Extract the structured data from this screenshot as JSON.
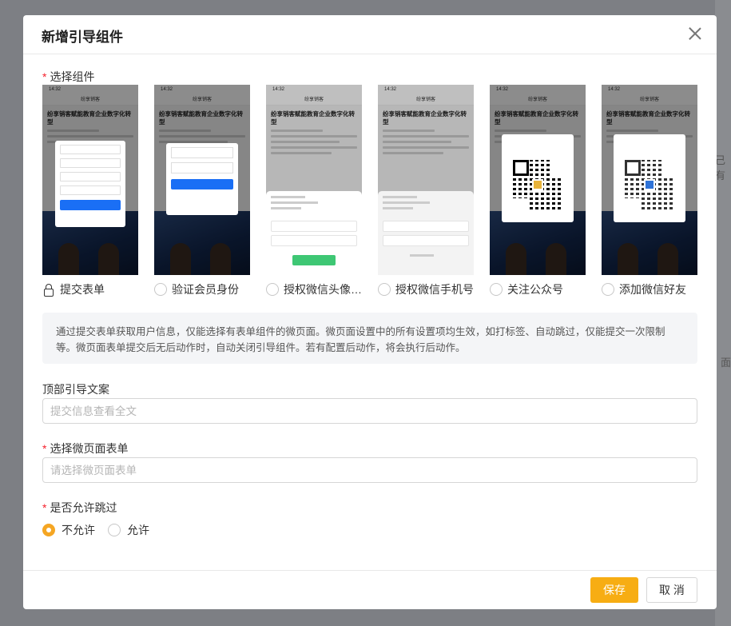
{
  "background": {
    "right_texts": [
      "己有",
      "面"
    ]
  },
  "modal": {
    "title": "新增引导组件",
    "close_icon": "close-icon",
    "component_section": {
      "required_mark": "*",
      "label": "选择组件",
      "cards": [
        {
          "label": "提交表单",
          "selected": true,
          "icon": "lock-icon"
        },
        {
          "label": "验证会员身份",
          "selected": false
        },
        {
          "label": "授权微信头像…",
          "selected": false
        },
        {
          "label": "授权微信手机号",
          "selected": false
        },
        {
          "label": "关注公众号",
          "selected": false
        },
        {
          "label": "添加微信好友",
          "selected": false
        }
      ],
      "thumb": {
        "time": "14:32",
        "nav_title": "纷享销客",
        "article_title": "纷享销客赋能教育企业数字化转型"
      }
    },
    "info_text": "通过提交表单获取用户信息，仅能选择有表单组件的微页面。微页面设置中的所有设置项均生效，如打标签、自动跳过，仅能提交一次限制等。微页面表单提交后无后动作时，自动关闭引导组件。若有配置后动作，将会执行后动作。",
    "top_copy": {
      "label": "顶部引导文案",
      "placeholder": "提交信息查看全文"
    },
    "form_select": {
      "required_mark": "*",
      "label": "选择微页面表单",
      "placeholder": "请选择微页面表单"
    },
    "skip": {
      "required_mark": "*",
      "label": "是否允许跳过",
      "options": [
        {
          "label": "不允许",
          "selected": true
        },
        {
          "label": "允许",
          "selected": false
        }
      ]
    },
    "footer": {
      "save_label": "保存",
      "cancel_label": "取 消"
    }
  },
  "colors": {
    "accent": "#f7ad13",
    "selected_radio": "#f5a623",
    "required": "#f5222d",
    "qr_center": "#2f73d8",
    "primary_blue": "#1a6ff5",
    "wechat_green": "#3ec774"
  }
}
